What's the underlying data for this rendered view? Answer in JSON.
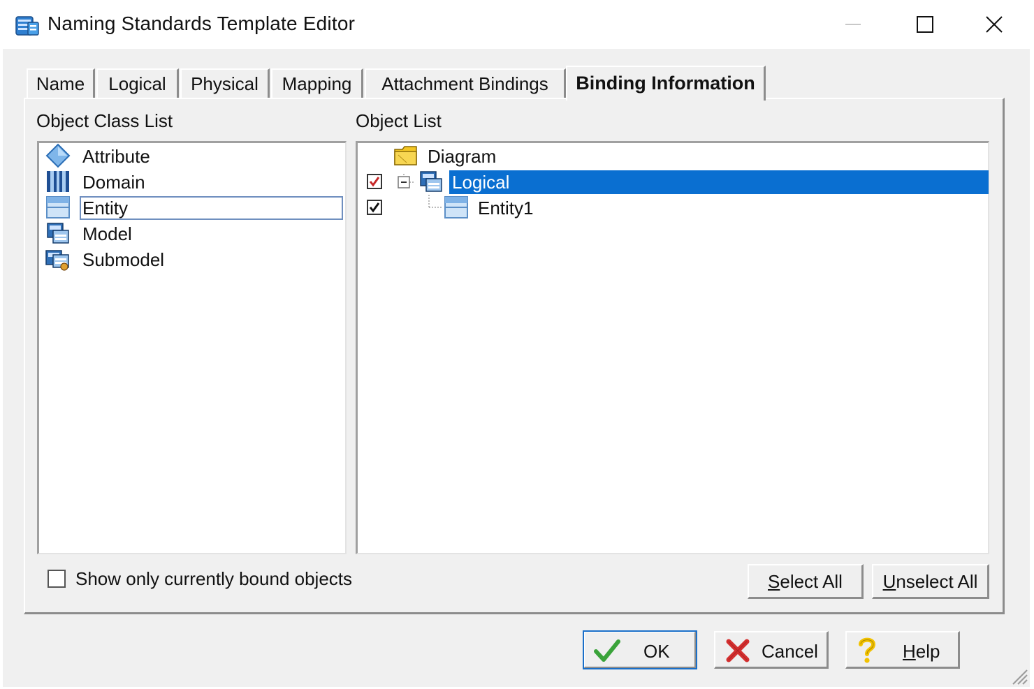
{
  "window": {
    "title": "Naming Standards Template Editor",
    "controls": [
      "minimize-icon",
      "maximize-icon",
      "close-icon"
    ]
  },
  "tabs": [
    {
      "label": "Name",
      "active": false
    },
    {
      "label": "Logical",
      "active": false
    },
    {
      "label": "Physical",
      "active": false
    },
    {
      "label": "Mapping",
      "active": false
    },
    {
      "label": "Attachment Bindings",
      "active": false
    },
    {
      "label": "Binding Information",
      "active": true
    }
  ],
  "object_class_list": {
    "label": "Object Class List",
    "items": [
      {
        "label": "Attribute",
        "icon": "attribute-icon"
      },
      {
        "label": "Domain",
        "icon": "domain-icon"
      },
      {
        "label": "Entity",
        "icon": "entity-icon",
        "focused": true
      },
      {
        "label": "Model",
        "icon": "model-icon"
      },
      {
        "label": "Submodel",
        "icon": "submodel-icon"
      }
    ]
  },
  "object_list": {
    "label": "Object List",
    "items": [
      {
        "label": "Diagram",
        "icon": "folder-icon",
        "checkbox": null
      },
      {
        "label": "Logical",
        "icon": "model-icon",
        "checkbox": "checked-red",
        "selected": true,
        "expander": "collapse"
      },
      {
        "label": "Entity1",
        "icon": "entity-icon",
        "checkbox": "checked"
      }
    ]
  },
  "show_bound": {
    "label": "Show only currently bound objects",
    "checked": false
  },
  "buttons": {
    "select_all": {
      "prefix": "S",
      "rest": "elect All"
    },
    "unselect_all": {
      "prefix": "U",
      "rest": "nselect All"
    },
    "ok": "OK",
    "cancel": "Cancel",
    "help": {
      "prefix": "H",
      "rest": "elp"
    }
  },
  "colors": {
    "selection": "#0a6fd1",
    "default_button_outline": "#1a6fc9",
    "check_red": "#c62828",
    "ok_green": "#3aa33a",
    "cancel_red": "#d32f2f",
    "help_yellow": "#f2c200"
  }
}
